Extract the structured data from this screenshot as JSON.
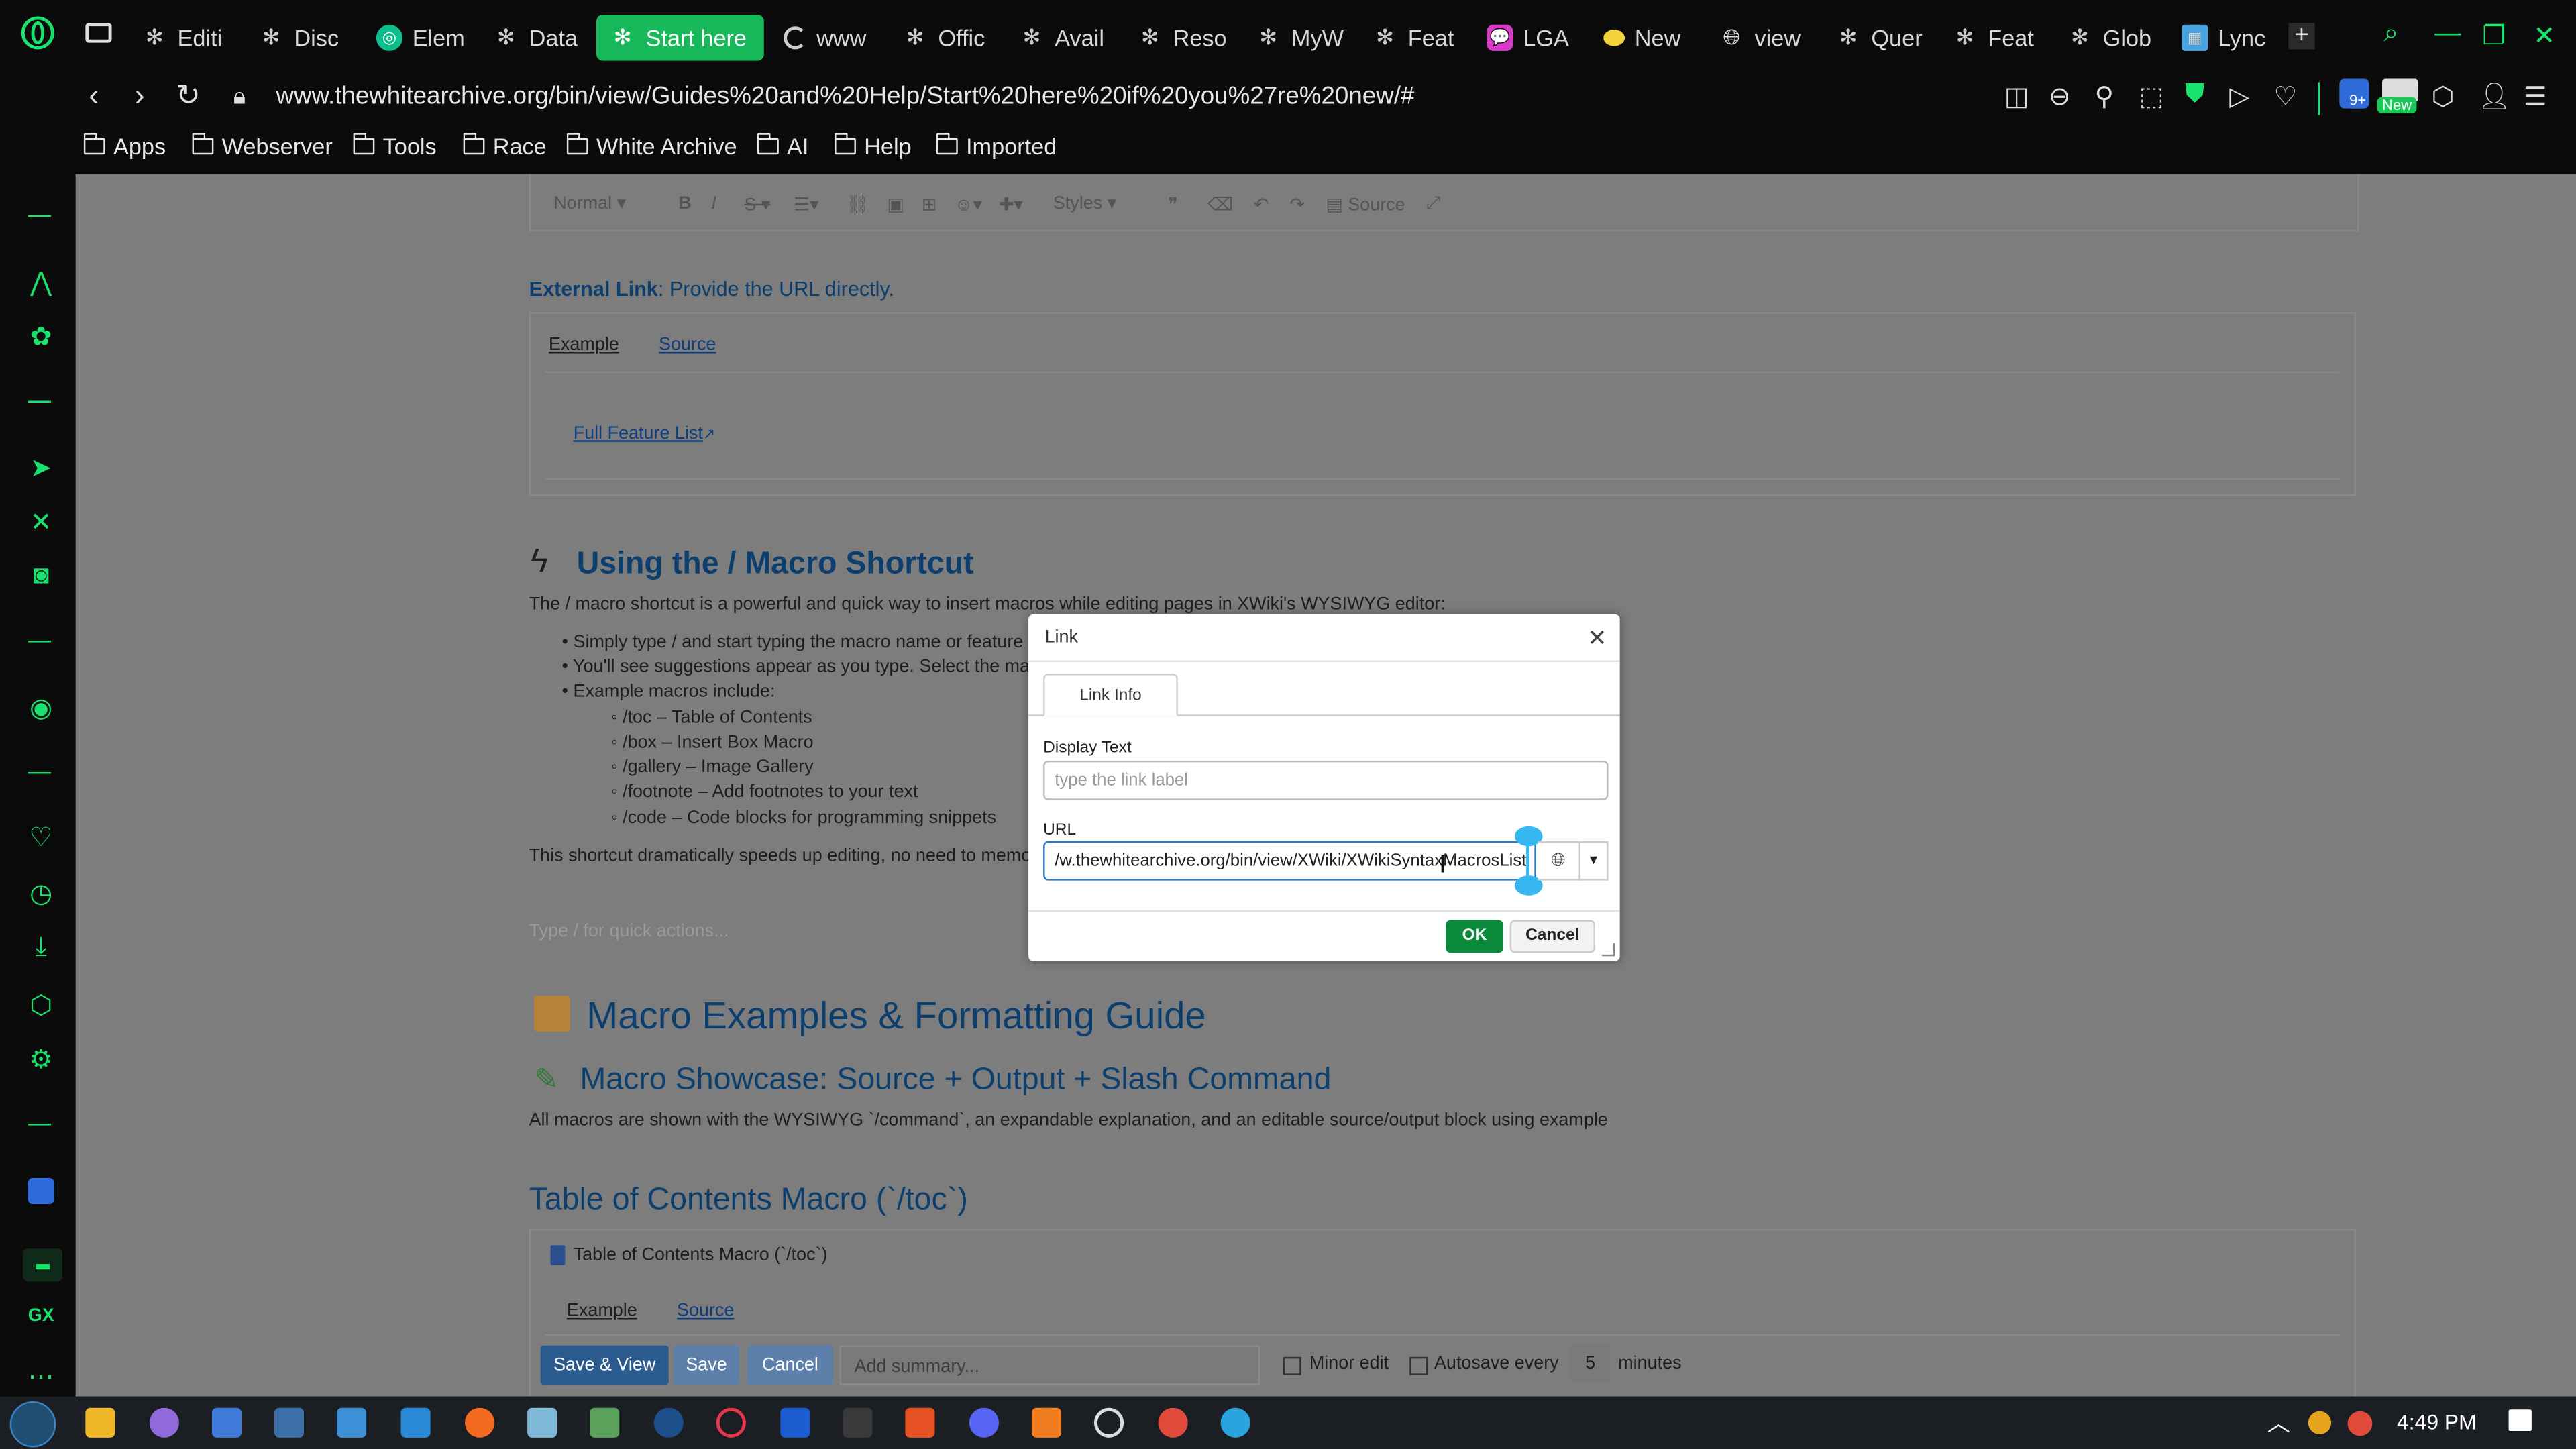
{
  "browser": {
    "tabs": [
      {
        "label": "Editi",
        "icon": "star-icon"
      },
      {
        "label": "Disc",
        "icon": "star-icon"
      },
      {
        "label": "Elem",
        "icon": "element-icon"
      },
      {
        "label": "Data",
        "icon": "star-icon"
      },
      {
        "label": "Start here",
        "icon": "star-icon",
        "active": true
      },
      {
        "label": "www",
        "icon": "loading-icon"
      },
      {
        "label": "Offic",
        "icon": "star-icon"
      },
      {
        "label": "Avail",
        "icon": "star-icon"
      },
      {
        "label": "Reso",
        "icon": "star-icon"
      },
      {
        "label": "MyW",
        "icon": "star-icon"
      },
      {
        "label": "Feat",
        "icon": "star-icon"
      },
      {
        "label": "LGA",
        "icon": "chat-icon"
      },
      {
        "label": "New",
        "icon": "lemon-icon"
      },
      {
        "label": "view",
        "icon": "globe-icon"
      },
      {
        "label": "Quer",
        "icon": "star-icon"
      },
      {
        "label": "Feat",
        "icon": "star-icon"
      },
      {
        "label": "Glob",
        "icon": "star-icon"
      },
      {
        "label": "Lync",
        "icon": "lync-icon"
      }
    ],
    "url": "www.thewhitearchive.org/bin/view/Guides%20and%20Help/Start%20here%20if%20you%27re%20new/#",
    "badges": {
      "notifications": "9+",
      "new": "New"
    },
    "bookmarks": [
      "Apps",
      "Webserver",
      "Tools",
      "Race",
      "White Archive",
      "AI",
      "Help",
      "Imported"
    ]
  },
  "editor": {
    "toolbar": {
      "format": "Normal",
      "styles": "Styles",
      "source": "Source"
    },
    "external_link": {
      "title": "External Link",
      "desc": ": Provide the URL directly."
    },
    "tabs": {
      "example": "Example",
      "source": "Source"
    },
    "example_link": "Full Feature List",
    "macro_shortcut": {
      "heading": "Using the / Macro Shortcut",
      "intro": "The / macro shortcut is a powerful and quick way to insert macros while editing pages in XWiki's WYSIWYG editor:",
      "bullets": [
        "Simply type / and start typing the macro name or feature y",
        "You'll see suggestions appear as you type. Select the ma",
        "Example macros include:"
      ],
      "examples": [
        "/toc – Table of Contents",
        "/box – Insert Box Macro",
        "/gallery – Image Gallery",
        "/footnote – Add footnotes to your text",
        "/code – Code blocks for programming snippets"
      ],
      "outro": "This shortcut dramatically speeds up editing, no need to memori"
    },
    "placeholder": "Type / for quick actions...",
    "guide_heading": "Macro Examples & Formatting Guide",
    "showcase_heading": "Macro Showcase: Source + Output + Slash Command",
    "showcase_desc": "All macros are shown with the WYSIWYG `/command`, an expandable explanation, and an editable source/output block using example",
    "toc_heading": "Table of Contents Macro (`/toc`)",
    "toc_box_title": "Table of Contents Macro (`/toc`)",
    "bottom": {
      "save_view": "Save & View",
      "save": "Save",
      "cancel": "Cancel",
      "summary_placeholder": "Add summary...",
      "minor_edit": "Minor edit",
      "autosave": "Autosave every",
      "minutes_value": "5",
      "minutes_label": "minutes"
    }
  },
  "dialog": {
    "title": "Link",
    "tab": "Link Info",
    "display_text_label": "Display Text",
    "display_text_placeholder": "type the link label",
    "url_label": "URL",
    "url_value": "/w.thewhitearchive.org/bin/view/XWiki/XWikiSyntaxMacrosList",
    "ok": "OK",
    "cancel": "Cancel"
  },
  "taskbar": {
    "time": "4:49 PM"
  },
  "colors": {
    "accent": "#19e36e",
    "page_bg": "#7d7d7d",
    "ok_green": "#0a8a3a",
    "save_blue": "#2b5a8e"
  }
}
